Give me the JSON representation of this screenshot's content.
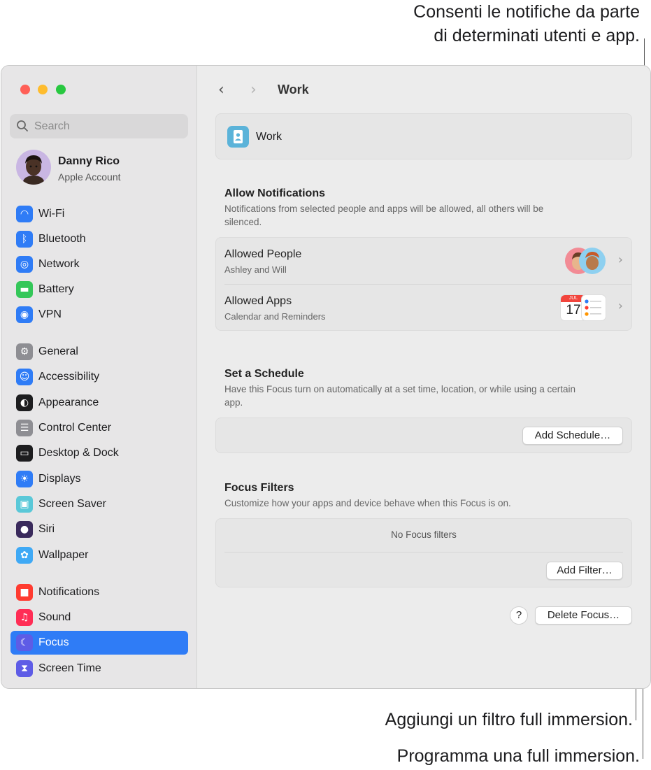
{
  "callouts": {
    "allow_notifications_line1": "Consenti le notifiche da parte",
    "allow_notifications_line2": "di determinati utenti e app.",
    "add_filter": "Aggiungi un filtro full immersion.",
    "add_schedule": "Programma una full immersion."
  },
  "sidebar": {
    "search_placeholder": "Search",
    "user": {
      "name": "Danny Rico",
      "subtitle": "Apple Account"
    },
    "items": [
      {
        "label": "Wi-Fi",
        "icon": "wifi-icon",
        "color": "#2f7cf6"
      },
      {
        "label": "Bluetooth",
        "icon": "bluetooth-icon",
        "color": "#2f7cf6"
      },
      {
        "label": "Network",
        "icon": "network-icon",
        "color": "#2f7cf6"
      },
      {
        "label": "Battery",
        "icon": "battery-icon",
        "color": "#34c759"
      },
      {
        "label": "VPN",
        "icon": "vpn-icon",
        "color": "#2f7cf6"
      },
      {
        "label": "General",
        "icon": "gear-icon",
        "color": "#8e8e93"
      },
      {
        "label": "Accessibility",
        "icon": "accessibility-icon",
        "color": "#2f7cf6"
      },
      {
        "label": "Appearance",
        "icon": "appearance-icon",
        "color": "#1d1d1f"
      },
      {
        "label": "Control Center",
        "icon": "control-center-icon",
        "color": "#8e8e93"
      },
      {
        "label": "Desktop & Dock",
        "icon": "dock-icon",
        "color": "#1d1d1f"
      },
      {
        "label": "Displays",
        "icon": "displays-icon",
        "color": "#2f7cf6"
      },
      {
        "label": "Screen Saver",
        "icon": "screen-saver-icon",
        "color": "#5ac8d8"
      },
      {
        "label": "Siri",
        "icon": "siri-icon",
        "color": "#3a2a5c"
      },
      {
        "label": "Wallpaper",
        "icon": "wallpaper-icon",
        "color": "#3fa9f5"
      },
      {
        "label": "Notifications",
        "icon": "notifications-icon",
        "color": "#ff3b30"
      },
      {
        "label": "Sound",
        "icon": "sound-icon",
        "color": "#ff2d55"
      },
      {
        "label": "Focus",
        "icon": "moon-icon",
        "color": "#5e5ce6"
      },
      {
        "label": "Screen Time",
        "icon": "hourglass-icon",
        "color": "#5e5ce6"
      }
    ],
    "active_item": "Focus"
  },
  "main": {
    "title": "Work",
    "focus_name": "Work",
    "allow_notifications": {
      "title": "Allow Notifications",
      "description": "Notifications from selected people and apps will be allowed, all others will be silenced.",
      "allowed_people": {
        "title": "Allowed People",
        "subtitle": "Ashley and Will"
      },
      "allowed_apps": {
        "title": "Allowed Apps",
        "subtitle": "Calendar and Reminders",
        "calendar_month": "JUL",
        "calendar_day": "17"
      }
    },
    "schedule": {
      "title": "Set a Schedule",
      "description": "Have this Focus turn on automatically at a set time, location, or while using a certain app.",
      "button": "Add Schedule…"
    },
    "filters": {
      "title": "Focus Filters",
      "description": "Customize how your apps and device behave when this Focus is on.",
      "empty": "No Focus filters",
      "button": "Add Filter…"
    },
    "help_label": "?",
    "delete_button": "Delete Focus…"
  }
}
